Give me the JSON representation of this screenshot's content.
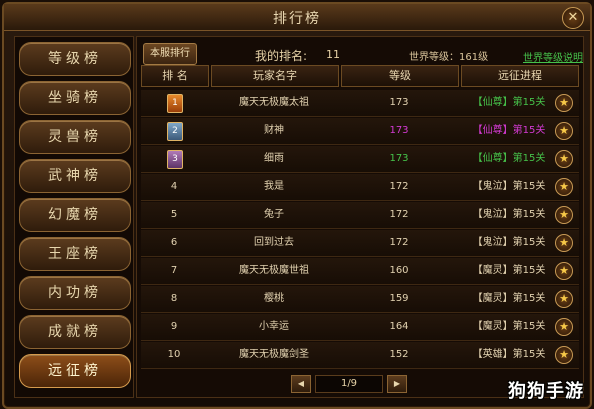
{
  "window": {
    "title": "排行榜",
    "close_label": "✕"
  },
  "sidebar": {
    "items": [
      {
        "label": "等级榜"
      },
      {
        "label": "坐骑榜"
      },
      {
        "label": "灵兽榜"
      },
      {
        "label": "武神榜"
      },
      {
        "label": "幻魔榜"
      },
      {
        "label": "王座榜"
      },
      {
        "label": "内功榜"
      },
      {
        "label": "成就榜"
      },
      {
        "label": "远征榜",
        "active": true
      }
    ]
  },
  "main": {
    "tab_label": "本服排行",
    "my_rank_label": "我的排名:",
    "my_rank_value": "11",
    "world_level": "世界等级：161级",
    "world_link": "世界等级说明",
    "columns": [
      "排 名",
      "玩家名字",
      "等级",
      "远征进程"
    ],
    "rows": [
      {
        "rank": "1",
        "name": "魔天无极魔太祖",
        "level": "173",
        "progress": "【仙尊】第15关",
        "level_color": "#e2d2b0",
        "prog_color": "#46c24a",
        "medal": "gold"
      },
      {
        "rank": "2",
        "name": "财神",
        "level": "173",
        "progress": "【仙尊】第15关",
        "level_color": "#d23ad2",
        "prog_color": "#d23ad2",
        "medal": "silver"
      },
      {
        "rank": "3",
        "name": "细雨",
        "level": "173",
        "progress": "【仙尊】第15关",
        "level_color": "#46c24a",
        "prog_color": "#46c24a",
        "medal": "bronze"
      },
      {
        "rank": "4",
        "name": "我是",
        "level": "172",
        "progress": "【鬼泣】第15关",
        "level_color": "#e2d2b0",
        "prog_color": "#e2d2b0"
      },
      {
        "rank": "5",
        "name": "兔子",
        "level": "172",
        "progress": "【鬼泣】第15关",
        "level_color": "#e2d2b0",
        "prog_color": "#e2d2b0"
      },
      {
        "rank": "6",
        "name": "回到过去",
        "level": "172",
        "progress": "【鬼泣】第15关",
        "level_color": "#e2d2b0",
        "prog_color": "#e2d2b0"
      },
      {
        "rank": "7",
        "name": "魔天无极魔世祖",
        "level": "160",
        "progress": "【魔灵】第15关",
        "level_color": "#e2d2b0",
        "prog_color": "#e2d2b0"
      },
      {
        "rank": "8",
        "name": "樱桃",
        "level": "159",
        "progress": "【魔灵】第15关",
        "level_color": "#e2d2b0",
        "prog_color": "#e2d2b0"
      },
      {
        "rank": "9",
        "name": "小幸运",
        "level": "164",
        "progress": "【魔灵】第15关",
        "level_color": "#e2d2b0",
        "prog_color": "#e2d2b0"
      },
      {
        "rank": "10",
        "name": "魔天无极魔剑圣",
        "level": "152",
        "progress": "【英雄】第15关",
        "level_color": "#e2d2b0",
        "prog_color": "#e2d2b0"
      }
    ],
    "pager": {
      "text": "1/9",
      "prev": "◀",
      "next": "▶"
    }
  },
  "watermark": "狗狗手游"
}
